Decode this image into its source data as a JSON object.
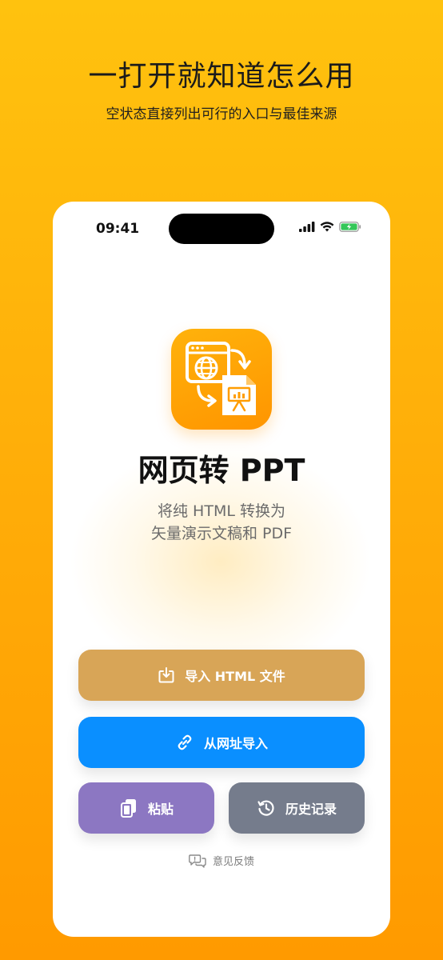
{
  "promo": {
    "headline": "一打开就知道怎么用",
    "subheadline": "空状态直接列出可行的入口与最佳来源"
  },
  "status_bar": {
    "time": "09:41"
  },
  "app": {
    "name": "网页转 PPT",
    "tagline_line1": "将纯 HTML 转换为",
    "tagline_line2": "矢量演示文稿和 PDF"
  },
  "actions": {
    "import_html": "导入 HTML 文件",
    "import_url": "从网址导入",
    "paste": "粘贴",
    "history": "历史记录",
    "feedback": "意见反馈"
  },
  "colors": {
    "import_button": "#D8A557",
    "url_button": "#0A8FFF",
    "paste_button": "#8C77C2",
    "history_button": "#757C8C",
    "accent_orange": "#FF9D00"
  },
  "icons": {
    "import": "import-icon",
    "link": "link-icon",
    "paste": "paste-icon",
    "history": "history-icon",
    "feedback": "feedback-icon"
  }
}
